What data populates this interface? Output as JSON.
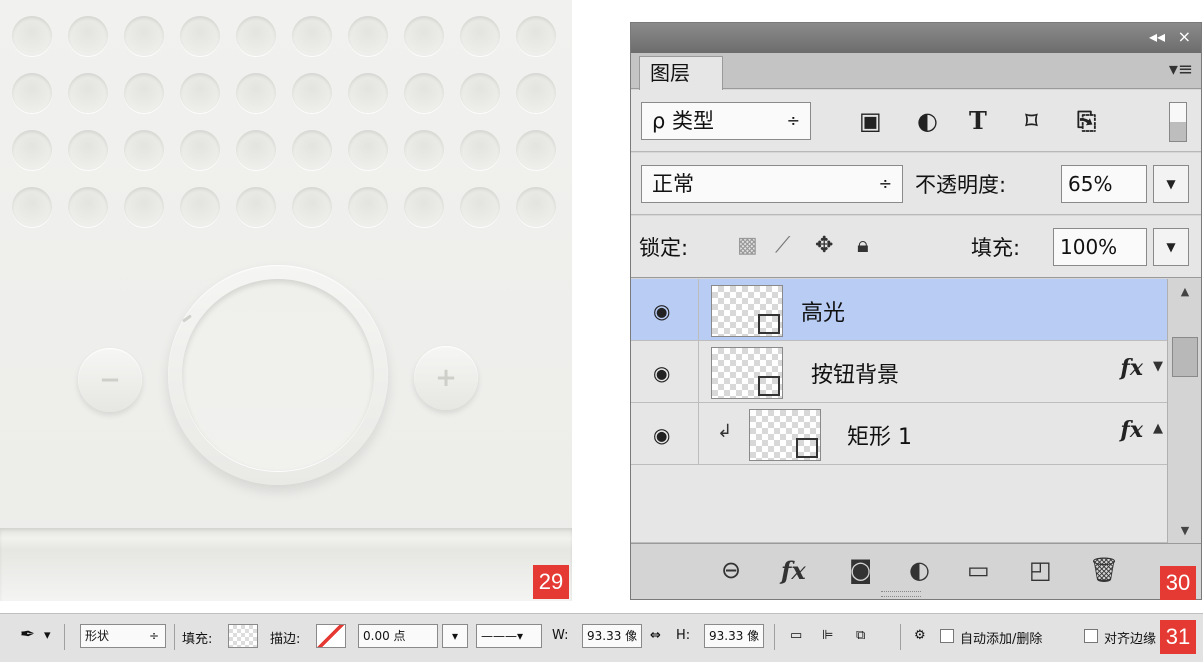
{
  "badges": {
    "artwork": "29",
    "panel": "30",
    "optbar": "31"
  },
  "artwork": {
    "minus_glyph": "−",
    "plus_glyph": "+"
  },
  "panel": {
    "titlebar": {
      "collapse_glyph": "◂◂",
      "close_glyph": "×"
    },
    "tab_label": "图层",
    "menu_glyph": "▾≡",
    "filter": {
      "kind_label": "ρ 类型",
      "kind_arrow": "÷",
      "icons": [
        "image-filter-icon",
        "adjustment-filter-icon",
        "type-filter-icon",
        "shape-filter-icon",
        "smart-object-filter-icon"
      ]
    },
    "blend": {
      "mode": "正常",
      "mode_arrow": "÷",
      "opacity_label": "不透明度:",
      "opacity_value": "65%"
    },
    "lock": {
      "label": "锁定:",
      "fill_label": "填充:",
      "fill_value": "100%"
    },
    "layers": [
      {
        "name": "高光",
        "selected": true,
        "fx": false,
        "clipped": false
      },
      {
        "name": "按钮背景",
        "selected": false,
        "fx": true,
        "clipped": false
      },
      {
        "name": "矩形 1",
        "selected": false,
        "fx": true,
        "clipped": true
      }
    ],
    "fx_glyph": "fx",
    "footer_icons": [
      "link-layers-icon",
      "add-style-icon",
      "add-mask-icon",
      "new-adjustment-icon",
      "new-group-icon",
      "new-layer-icon",
      "delete-layer-icon"
    ]
  },
  "optbar": {
    "mode_value": "形状",
    "mode_arrow": "÷",
    "fill_label": "填充:",
    "stroke_label": "描边:",
    "stroke_width": "0.00 点",
    "w_label": "W:",
    "w_value": "93.33 像",
    "h_label": "H:",
    "h_value": "93.33 像",
    "auto_add_delete": "自动添加/删除",
    "align_edges": "对齐边缘"
  },
  "colors": {
    "badge_red": "#e53a33",
    "selected_layer": "#b8ccf4",
    "panel_bg": "#e6e6e6"
  }
}
